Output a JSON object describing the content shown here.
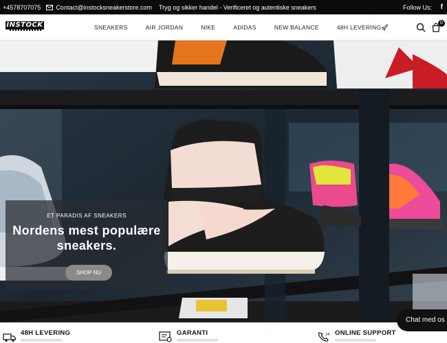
{
  "topbar": {
    "phone": "+4578707075",
    "email": "Contact@instocksneakerstore.com",
    "trust": "Tryg og sikker handel - Verificeret og autentiske sneakers",
    "follow": "Follow Us:",
    "social_icon": "facebook-icon"
  },
  "header": {
    "logo": "INSTOCK",
    "nav": [
      "SNEAKERS",
      "AIR JORDAN",
      "NIKE",
      "ADIDAS",
      "NEW BALANCE",
      "48H LEVERING🚀"
    ],
    "cart_count": "0",
    "icons": [
      "search-icon",
      "cart-icon"
    ]
  },
  "hero": {
    "eyebrow": "ET PARADIS AF SNEAKERS",
    "headline": "Nordens mest populære sneakers.",
    "cta": "SHOP NU"
  },
  "chat": {
    "label": "Chat med os"
  },
  "features": [
    {
      "title": "48H LEVERING",
      "icon": "truck-icon"
    },
    {
      "title": "GARANTI",
      "icon": "certificate-icon"
    },
    {
      "title": "ONLINE SUPPORT",
      "icon": "support-phone-icon"
    }
  ],
  "colors": {
    "topbar": "#0b0b0b",
    "accent": "#111111",
    "overlay": "#282d32",
    "cta": "#8a8a8a"
  }
}
